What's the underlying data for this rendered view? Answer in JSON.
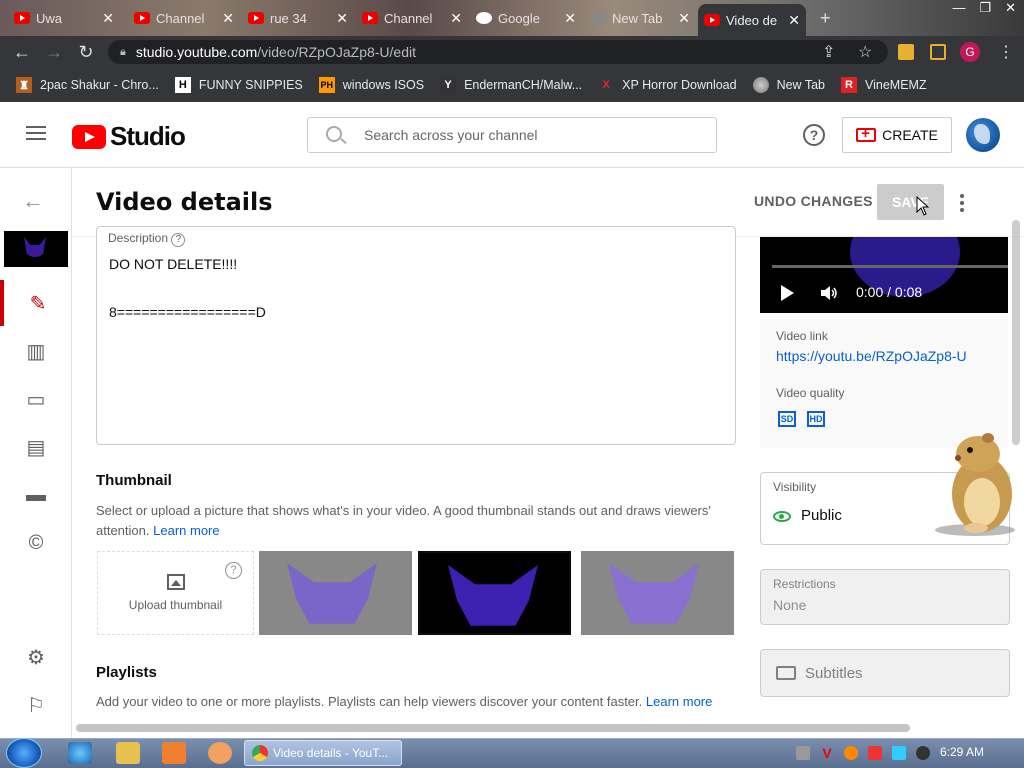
{
  "browser": {
    "tabs": [
      {
        "label": "Uwa"
      },
      {
        "label": "Channel"
      },
      {
        "label": "rue 34"
      },
      {
        "label": "Channel"
      },
      {
        "label": "Google"
      },
      {
        "label": "New Tab"
      },
      {
        "label": "Video de"
      }
    ],
    "url_host": "studio.youtube.com",
    "url_path": "/video/RZpOJaZp8-U/edit",
    "profile_initial": "G",
    "bookmarks": [
      {
        "label": "2pac Shakur - Chro...",
        "icon": "H"
      },
      {
        "label": "FUNNY SNIPPIES",
        "icon": "H"
      },
      {
        "label": "windows ISOS",
        "icon": "PH"
      },
      {
        "label": "EndermanCH/Malw...",
        "icon": "Y"
      },
      {
        "label": "XP Horror Download",
        "icon": "X"
      },
      {
        "label": "New Tab",
        "icon": "globe"
      },
      {
        "label": "VineMEMZ",
        "icon": "R"
      }
    ]
  },
  "header": {
    "logo_text": "Studio",
    "search_placeholder": "Search across your channel",
    "create_label": "CREATE"
  },
  "page": {
    "title": "Video details",
    "undo_label": "UNDO CHANGES",
    "save_label": "SAVE"
  },
  "description": {
    "label": "Description",
    "text": "DO NOT DELETE!!!!\n\n8=================D"
  },
  "thumbnail": {
    "heading": "Thumbnail",
    "desc": "Select or upload a picture that shows what's in your video. A good thumbnail stands out and draws viewers' attention.",
    "learn_more": "Learn more",
    "upload_label": "Upload thumbnail"
  },
  "playlists": {
    "heading": "Playlists",
    "desc": "Add your video to one or more playlists. Playlists can help viewers discover your content faster.",
    "learn_more": "Learn more"
  },
  "video": {
    "timecode": "0:00 / 0:08",
    "link_label": "Video link",
    "link": "https://youtu.be/RZpOJaZp8-U",
    "quality_label": "Video quality",
    "quality_sd": "SD",
    "quality_hd": "HD"
  },
  "visibility": {
    "label": "Visibility",
    "value": "Public"
  },
  "restrictions": {
    "label": "Restrictions",
    "value": "None"
  },
  "subtitles": {
    "label": "Subtitles"
  },
  "taskbar": {
    "active_window": "Video details - YouT...",
    "clock": "6:29 AM"
  },
  "colors": {
    "accent_red": "#cc0000",
    "link_blue": "#065fd4",
    "public_green": "#2ba640"
  }
}
